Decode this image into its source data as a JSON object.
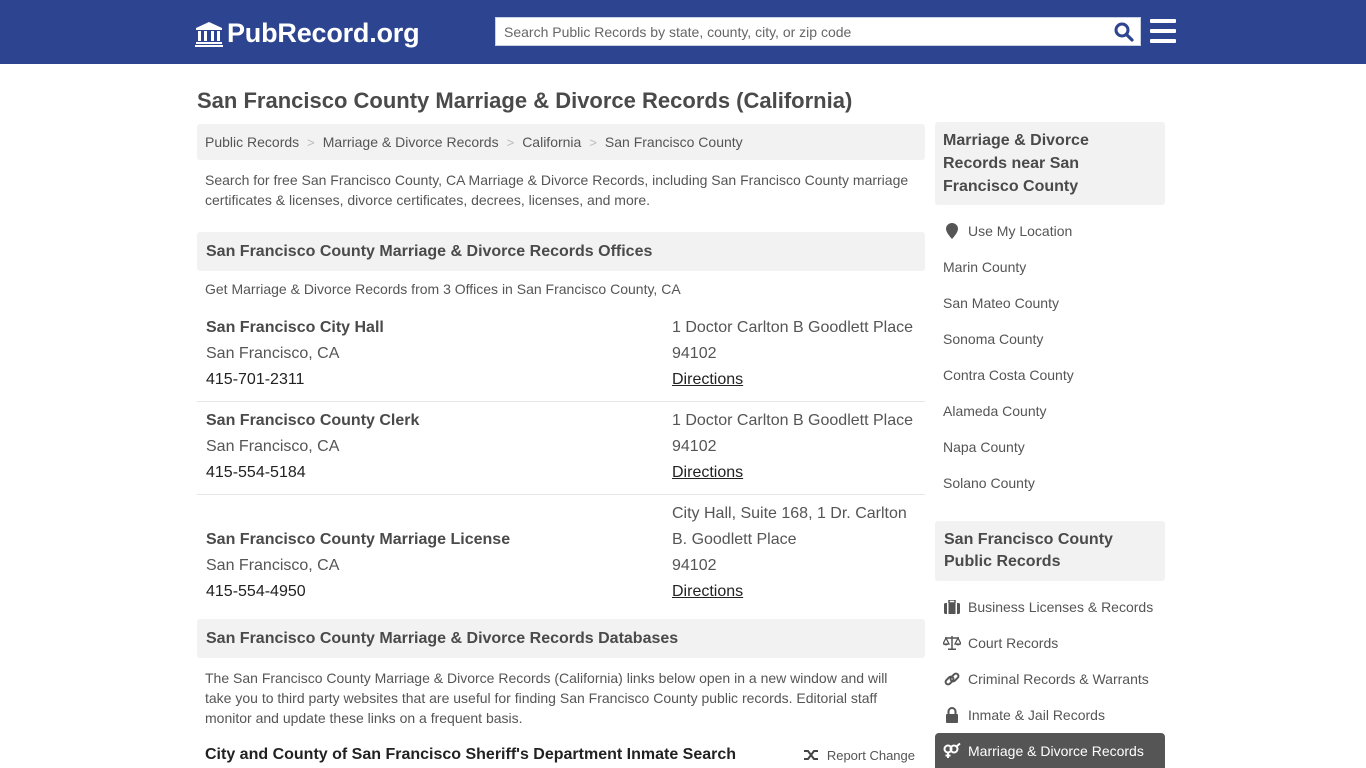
{
  "header": {
    "logo_text": "PubRecord.org",
    "search_placeholder": "Search Public Records by state, county, city, or zip code",
    "brand_color": "#2d4590"
  },
  "page": {
    "title": "San Francisco County Marriage & Divorce Records (California)"
  },
  "breadcrumb": [
    "Public Records",
    "Marriage & Divorce Records",
    "California",
    "San Francisco County"
  ],
  "intro": "Search for free San Francisco County, CA Marriage & Divorce Records, including San Francisco County marriage certificates & licenses, divorce certificates, decrees, licenses, and more.",
  "offices_section": {
    "heading": "San Francisco County Marriage & Divorce Records Offices",
    "subtext": "Get Marriage & Divorce Records from 3 Offices in San Francisco County, CA",
    "offices": [
      {
        "name": "San Francisco City Hall",
        "city": "San Francisco, CA",
        "phone": "415-701-2311",
        "address_lines": [
          "1 Doctor Carlton B Goodlett Place",
          "94102"
        ],
        "directions": "Directions"
      },
      {
        "name": "San Francisco County Clerk",
        "city": "San Francisco, CA",
        "phone": "415-554-5184",
        "address_lines": [
          "1 Doctor Carlton B Goodlett Place",
          "94102"
        ],
        "directions": "Directions"
      },
      {
        "name": "San Francisco County Marriage License",
        "city": "San Francisco, CA",
        "phone": "415-554-4950",
        "address_lines": [
          "City Hall, Suite 168, 1 Dr. Carlton",
          "B. Goodlett Place",
          "94102"
        ],
        "directions": "Directions"
      }
    ]
  },
  "databases_section": {
    "heading": "San Francisco County Marriage & Divorce Records Databases",
    "intro": "The San Francisco County Marriage & Divorce Records (California) links below open in a new window and will take you to third party websites that are useful for finding San Francisco County public records. Editorial staff monitor and update these links on a frequent basis.",
    "first_link_title": "City and County of San Francisco Sheriff's Department Inmate Search",
    "report_change": "Report Change"
  },
  "sidebar": {
    "nearby_heading": "Marriage & Divorce Records near San Francisco County",
    "use_location": "Use My Location",
    "nearby": [
      "Marin County",
      "San Mateo County",
      "Sonoma County",
      "Contra Costa County",
      "Alameda County",
      "Napa County",
      "Solano County"
    ],
    "public_heading": "San Francisco County Public Records",
    "public_links": [
      {
        "label": "Business Licenses & Records",
        "icon": "briefcase-icon"
      },
      {
        "label": "Court Records",
        "icon": "scales-icon"
      },
      {
        "label": "Criminal Records & Warrants",
        "icon": "link-icon"
      },
      {
        "label": "Inmate & Jail Records",
        "icon": "lock-icon"
      },
      {
        "label": "Marriage & Divorce Records",
        "icon": "gender-icon",
        "active": true
      }
    ]
  }
}
